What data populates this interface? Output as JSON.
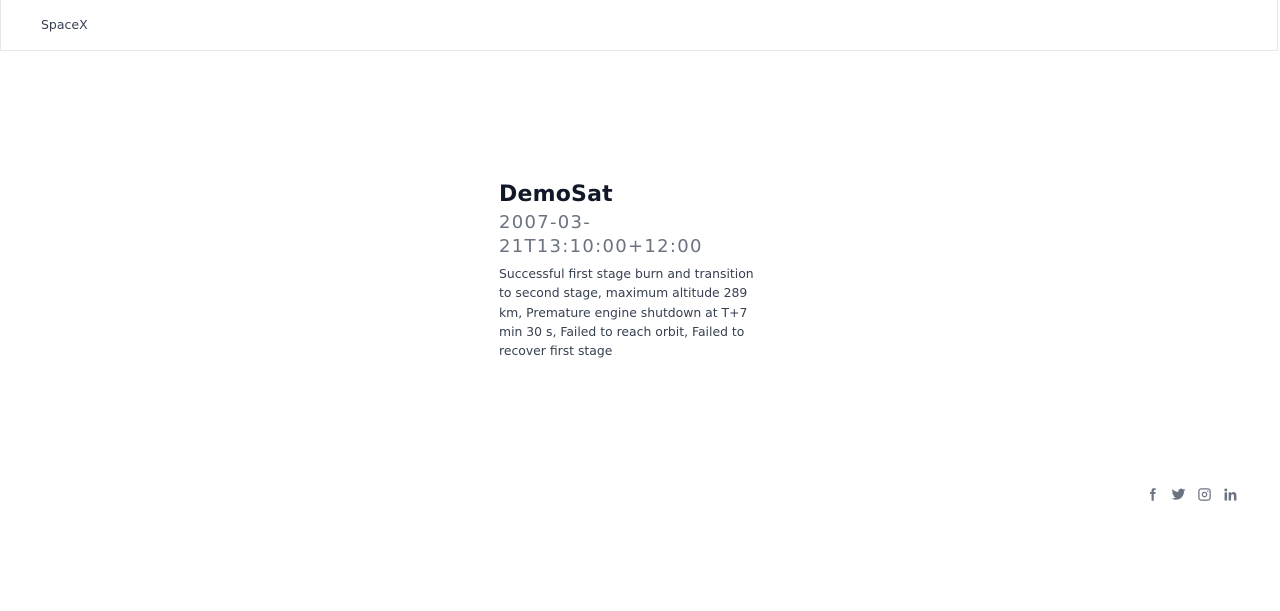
{
  "header": {
    "brand": "SpaceX"
  },
  "mission": {
    "name": "DemoSat",
    "launch_date": "2007-03-21T13:10:00+12:00",
    "details": "Successful first stage burn and transition to second stage, maximum altitude 289 km, Premature engine shutdown at T+7 min 30 s, Failed to reach orbit, Failed to recover first stage"
  },
  "footer": {
    "social_icons": [
      "facebook-icon",
      "twitter-icon",
      "instagram-icon",
      "linkedin-icon"
    ],
    "icon_color": "#6b7280"
  }
}
